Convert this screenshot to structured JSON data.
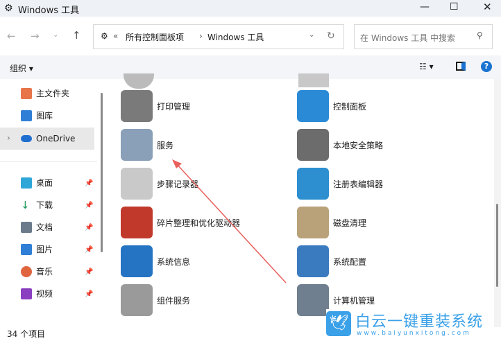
{
  "window": {
    "title": "Windows 工具"
  },
  "address": {
    "crumbs": [
      "所有控制面板项",
      "Windows 工具"
    ]
  },
  "search": {
    "placeholder": "在 Windows 工具 中搜索"
  },
  "toolbar": {
    "organize": "组织"
  },
  "sidebar": {
    "items": [
      {
        "label": "主文件夹",
        "color": "#e8744a"
      },
      {
        "label": "图库",
        "color": "#2f7fd6"
      },
      {
        "label": "OneDrive",
        "color": "#1f6fd1"
      },
      {
        "label": "桌面",
        "color": "#2ea6d8"
      },
      {
        "label": "下载",
        "color": "#1a9a5a"
      },
      {
        "label": "文档",
        "color": "#6b7b8c"
      },
      {
        "label": "图片",
        "color": "#2f7fd6"
      },
      {
        "label": "音乐",
        "color": "#e0653f"
      },
      {
        "label": "视频",
        "color": "#8a3fc0"
      }
    ]
  },
  "items": [
    {
      "label": "打印管理",
      "color": "#7a7a7a"
    },
    {
      "label": "控制面板",
      "color": "#2b8ad6"
    },
    {
      "label": "服务",
      "color": "#8aa0b8"
    },
    {
      "label": "本地安全策略",
      "color": "#6c6c6c"
    },
    {
      "label": "步骤记录器",
      "color": "#c9c9c9"
    },
    {
      "label": "注册表编辑器",
      "color": "#2d8fd0"
    },
    {
      "label": "碎片整理和优化驱动器",
      "color": "#c0392b"
    },
    {
      "label": "磁盘清理",
      "color": "#b9a27a"
    },
    {
      "label": "系统信息",
      "color": "#2574c4"
    },
    {
      "label": "系统配置",
      "color": "#3a7bbf"
    },
    {
      "label": "组件服务",
      "color": "#9a9a9a"
    },
    {
      "label": "计算机管理",
      "color": "#6f7f8f"
    }
  ],
  "status": {
    "count": "34 个项目"
  },
  "watermark": {
    "title": "白云一键重装系统",
    "url": "www.baiyunxitong.com"
  }
}
